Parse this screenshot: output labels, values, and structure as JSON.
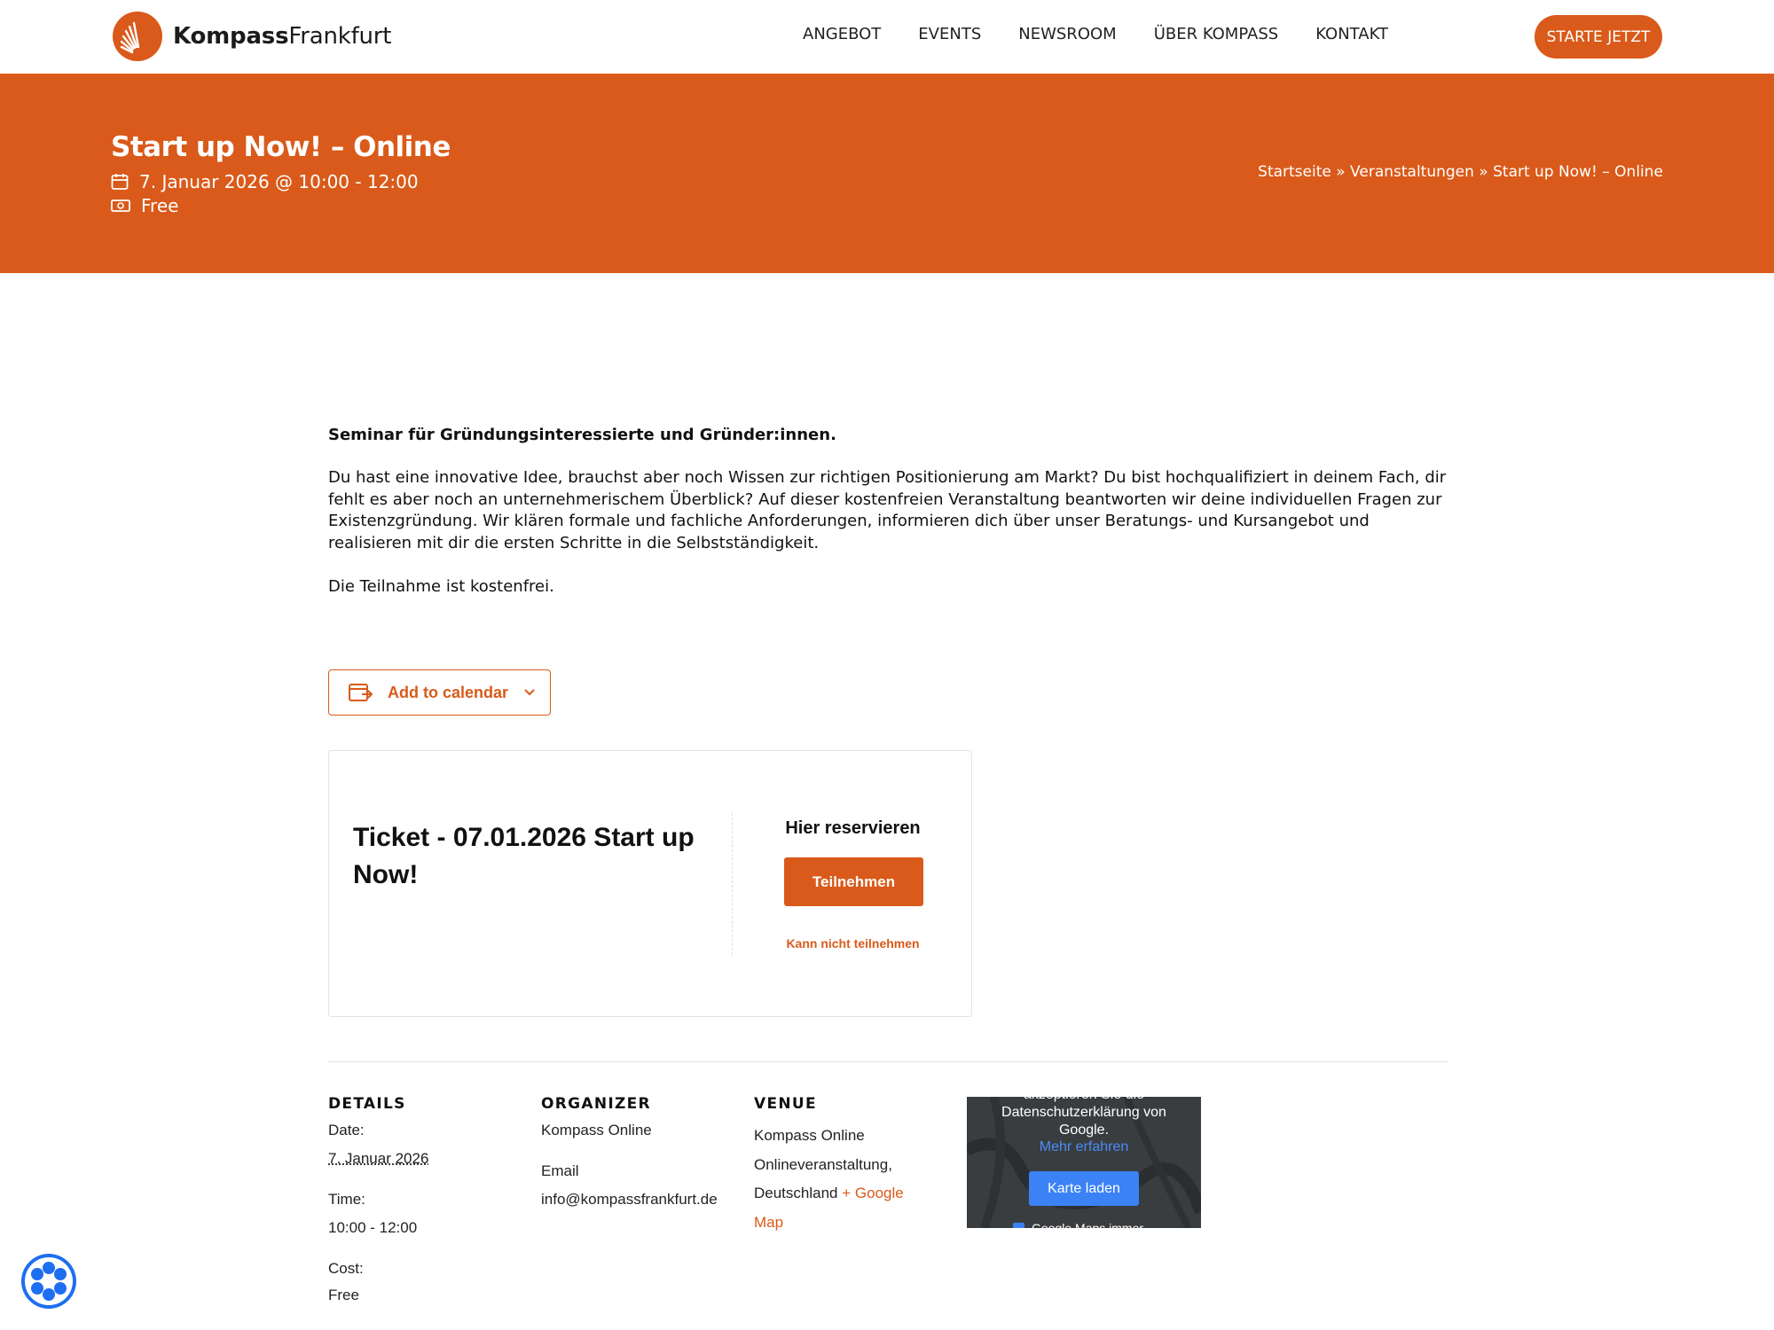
{
  "header": {
    "logo_bold": "Kompass",
    "logo_light": "Frankfurt",
    "nav": [
      "ANGEBOT",
      "EVENTS",
      "NEWSROOM",
      "ÜBER KOMPASS",
      "KONTAKT"
    ],
    "cta": "STARTE JETZT"
  },
  "hero": {
    "title": "Start up Now! – Online",
    "date": "7. Januar 2026 @ 10:00 - 12:00",
    "cost": "Free",
    "breadcrumb": "Startseite » Veranstaltungen » Start up Now! – Online"
  },
  "content": {
    "lead": "Seminar für Gründungsinteressierte und Gründer:innen.",
    "paragraph": "Du hast eine innovative Idee, brauchst aber noch Wissen zur richtigen Positionierung am Markt? Du bist hochqualifiziert in deinem Fach, dir fehlt es aber noch an unternehmerischem Überblick? Auf dieser kostenfreien Veranstaltung beantworten wir deine individuellen Fragen zur Existenzgründung. Wir klären formale und fachliche Anforderungen, informieren dich über unser Beratungs- und Kursangebot und realisieren mit dir die ersten Schritte in die Selbstständigkeit.",
    "note": "Die Teilnahme ist kostenfrei.",
    "add_to_calendar": "Add to calendar"
  },
  "ticket": {
    "title": "Ticket - 07.01.2026 Start up Now!",
    "reserve_heading": "Hier reservieren",
    "attend_button": "Teilnehmen",
    "decline_link": "Kann nicht teilnehmen"
  },
  "details": {
    "heading": "DETAILS",
    "date_label": "Date:",
    "date_value": "7. Januar 2026",
    "time_label": "Time:",
    "time_value": "10:00 - 12:00",
    "cost_label": "Cost:",
    "cost_value": "Free"
  },
  "organizer": {
    "heading": "ORGANIZER",
    "name": "Kompass Online",
    "email_label": "Email",
    "email_value": "info@kompassfrankfurt.de"
  },
  "venue": {
    "heading": "VENUE",
    "name": "Kompass Online",
    "line2": "Onlineveranstaltung,",
    "line3": "Deutschland",
    "map_link": "+ Google",
    "map_link2": "Map"
  },
  "map": {
    "notice_line1": "akzeptieren Sie die",
    "notice_line2": "Datenschutzerklärung von",
    "notice_line3": "Google.",
    "more": "Mehr erfahren",
    "load_button": "Karte laden",
    "checkbox_label": "Google Maps immer"
  },
  "colors": {
    "accent": "#d95a1a",
    "map_blue": "#3b82f6"
  }
}
